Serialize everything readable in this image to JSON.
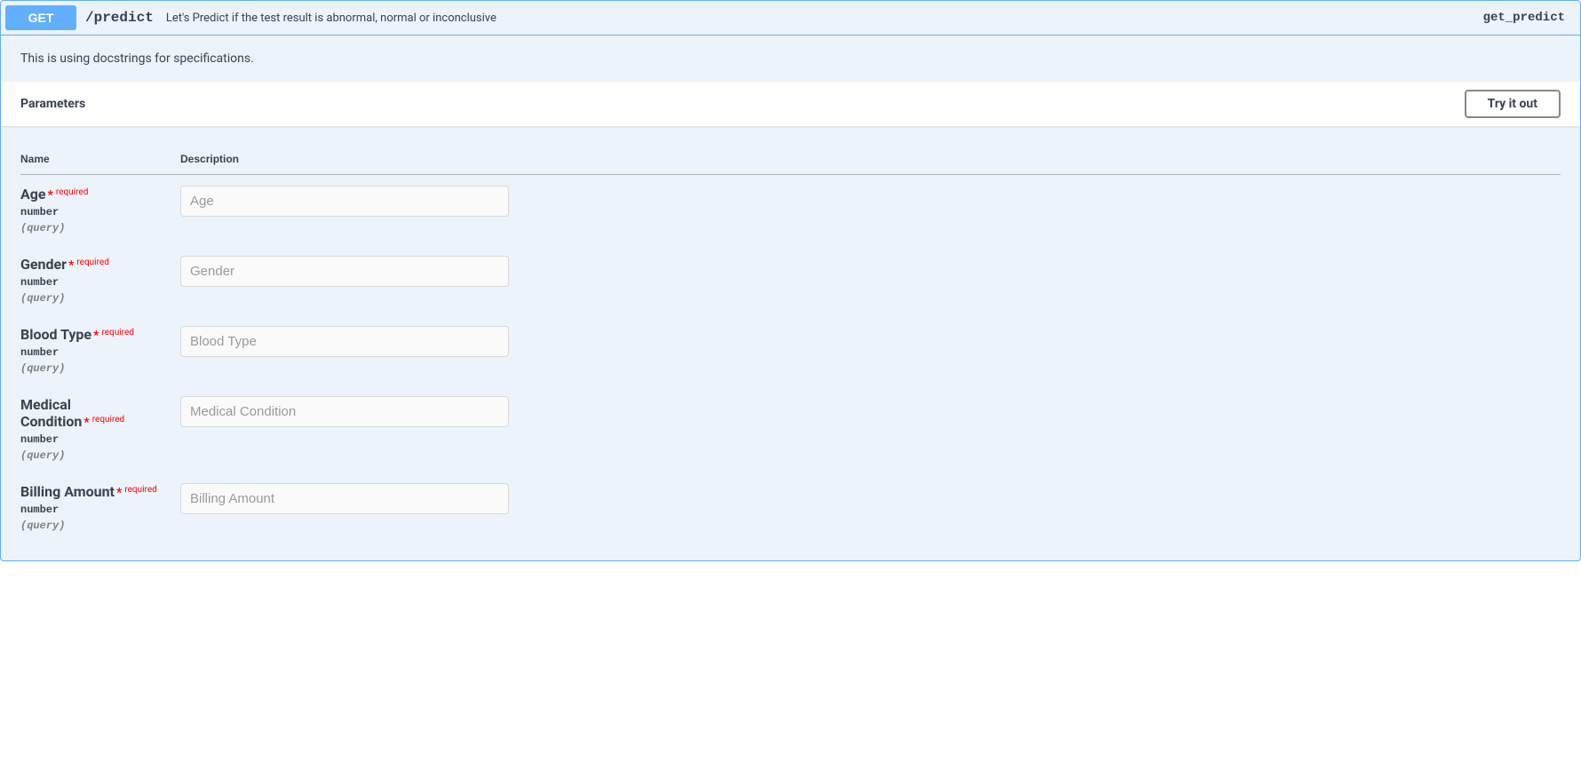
{
  "operation": {
    "method": "GET",
    "path": "/predict",
    "summary": "Let's Predict if the test result is abnormal, normal or inconclusive",
    "operation_id": "get_predict",
    "description": "This is using docstrings for specifications."
  },
  "section": {
    "parameters_title": "Parameters",
    "try_out_label": "Try it out"
  },
  "table_headers": {
    "name": "Name",
    "description": "Description"
  },
  "required_label": "required",
  "parameters": [
    {
      "name": "Age",
      "required": true,
      "type": "number",
      "in": "(query)",
      "placeholder": "Age"
    },
    {
      "name": "Gender",
      "required": true,
      "type": "number",
      "in": "(query)",
      "placeholder": "Gender"
    },
    {
      "name": "Blood Type",
      "required": true,
      "type": "number",
      "in": "(query)",
      "placeholder": "Blood Type"
    },
    {
      "name": "Medical Condition",
      "required": true,
      "type": "number",
      "in": "(query)",
      "placeholder": "Medical Condition"
    },
    {
      "name": "Billing Amount",
      "required": true,
      "type": "number",
      "in": "(query)",
      "placeholder": "Billing Amount"
    }
  ]
}
